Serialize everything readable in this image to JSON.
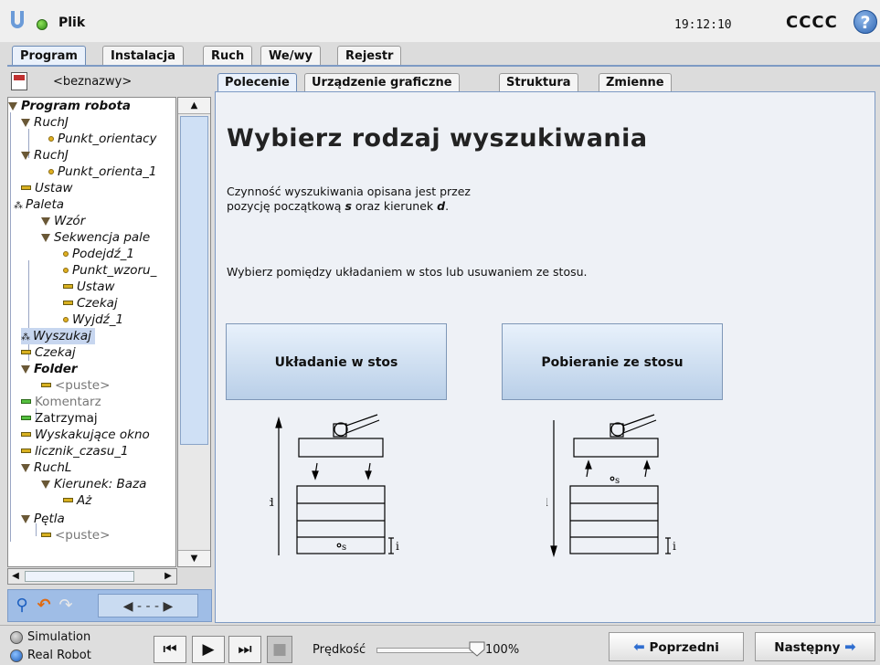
{
  "topbar": {
    "menu_label": "Plik",
    "time": "19:12:10",
    "robot_name": "CCCC",
    "help_symbol": "?"
  },
  "main_tabs": [
    {
      "label": "Program",
      "active": true
    },
    {
      "label": "Instalacja",
      "active": false
    },
    {
      "label": "Ruch",
      "active": false
    },
    {
      "label": "We/wy",
      "active": false
    },
    {
      "label": "Rejestr",
      "active": false
    }
  ],
  "program": {
    "file_name": "<beznazwy>",
    "tree": [
      {
        "label": "Program robota",
        "icon": "triangle-icon"
      },
      {
        "label": "RuchJ",
        "icon": "triangle-icon"
      },
      {
        "label": "Punkt_orientacy",
        "icon": "waypoint-icon"
      },
      {
        "label": "RuchJ",
        "icon": "triangle-icon"
      },
      {
        "label": "Punkt_orienta_1",
        "icon": "waypoint-icon"
      },
      {
        "label": "Ustaw",
        "icon": "command-icon"
      },
      {
        "label": "Paleta",
        "icon": "pallet-icon"
      },
      {
        "label": "Wzór",
        "icon": "triangle-icon"
      },
      {
        "label": "Sekwencja pale",
        "icon": "triangle-icon"
      },
      {
        "label": "Podejdź_1",
        "icon": "waypoint-icon"
      },
      {
        "label": "Punkt_wzoru_",
        "icon": "waypoint-icon"
      },
      {
        "label": "Ustaw",
        "icon": "command-icon"
      },
      {
        "label": "Czekaj",
        "icon": "command-icon"
      },
      {
        "label": "Wyjdź_1",
        "icon": "waypoint-icon"
      },
      {
        "label": "Wyszukaj",
        "icon": "pallet-icon"
      },
      {
        "label": "Czekaj",
        "icon": "command-icon"
      },
      {
        "label": "Folder",
        "icon": "triangle-icon"
      },
      {
        "label": "<puste>",
        "icon": "command-icon"
      },
      {
        "label": "Komentarz",
        "icon": "comment-icon"
      },
      {
        "label": "Zatrzymaj",
        "icon": "comment-icon"
      },
      {
        "label": "Wyskakujące okno",
        "icon": "command-icon"
      },
      {
        "label": "licznik_czasu_1",
        "icon": "command-icon"
      },
      {
        "label": "RuchL",
        "icon": "triangle-icon"
      },
      {
        "label": "Kierunek: Baza",
        "icon": "triangle-icon"
      },
      {
        "label": "Aż",
        "icon": "command-icon"
      },
      {
        "label": "Pętla",
        "icon": "triangle-icon"
      },
      {
        "label": "<puste>",
        "icon": "command-icon"
      }
    ]
  },
  "sub_tabs": [
    {
      "label": "Polecenie",
      "active": true
    },
    {
      "label": "Urządzenie graficzne",
      "active": false
    },
    {
      "label": "Struktura",
      "active": false
    },
    {
      "label": "Zmienne",
      "active": false
    }
  ],
  "content": {
    "title": "Wybierz rodzaj wyszukiwania",
    "description_line1": "Czynność wyszukiwania opisana jest przez",
    "description_line2_prefix": "pozycję początkową ",
    "description_s": "s",
    "description_mid": " oraz kierunek ",
    "description_d": "d",
    "description_end": ".",
    "instruction": "Wybierz pomiędzy układaniem w stos lub usuwaniem ze stosu.",
    "stack_button": "Układanie w stos",
    "destack_button": "Pobieranie ze stosu",
    "diagram_label_d": "d",
    "diagram_label_s": "s",
    "diagram_label_i": "i"
  },
  "bottombar": {
    "simulation_label": "Simulation",
    "real_robot_label": "Real Robot",
    "speed_label": "Prędkość",
    "speed_value": "100%",
    "speed_fraction": 1.0,
    "prev_button": "Poprzedni",
    "next_button": "Następny"
  },
  "colors": {
    "accent": "#7d9ac4",
    "button_blue": "#b9cfe8",
    "selection": "#c7d6ef"
  }
}
